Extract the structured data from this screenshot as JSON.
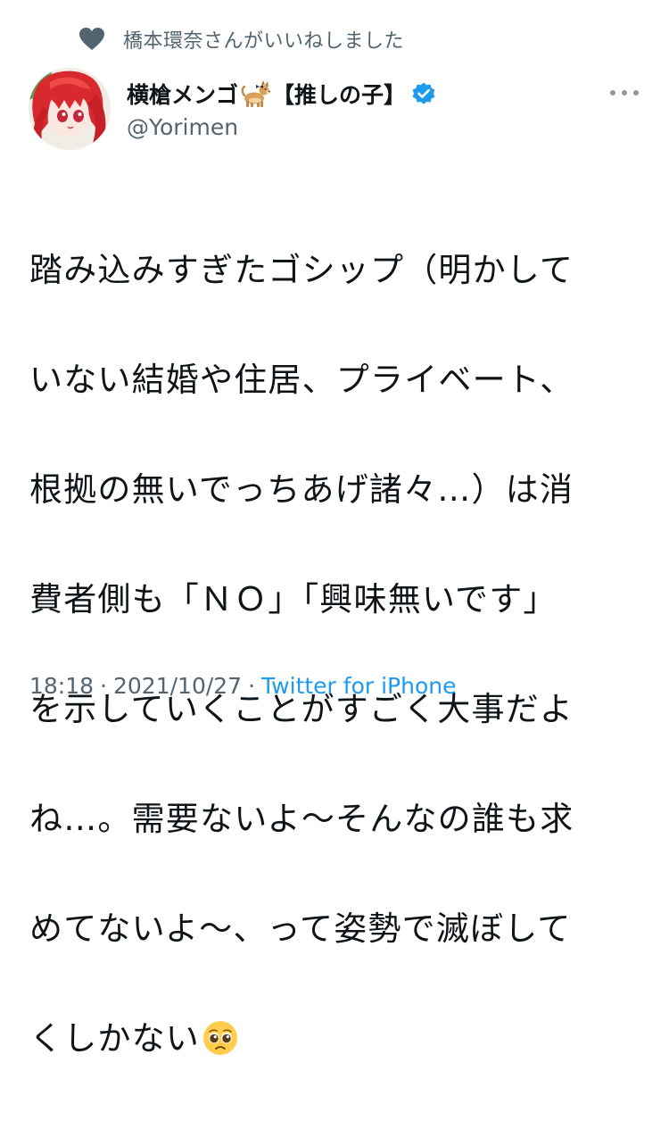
{
  "social_context": {
    "icon": "heart-icon",
    "text": "橋本環奈さんがいいねしました"
  },
  "author": {
    "display_name": "横槍メンゴ",
    "name_emoji": "dog-emoji",
    "display_name_suffix": "【推しの子】",
    "verified": true,
    "verified_color": "#1d9bf0",
    "handle": "@Yorimen"
  },
  "tweet": {
    "lines": [
      "踏み込みすぎたゴシップ（明かして",
      "いない結婚や住居、プライベート、",
      "根拠の無いでっちあげ諸々…）は消",
      "費者側も「ＮＯ」「興味無いです」",
      "を示していくことがすごく大事だよ",
      "ね…。需要ないよ〜そんなの誰も求",
      "めてないよ〜、って姿勢で滅ぼして",
      "くしかない"
    ],
    "trailing_emoji": "pleading-face-emoji"
  },
  "meta": {
    "time": "18:18",
    "separator": "·",
    "date": "2021/10/27",
    "source": "Twitter for iPhone"
  },
  "colors": {
    "text_primary": "#0f1419",
    "text_secondary": "#536471",
    "link": "#1d9bf0"
  }
}
